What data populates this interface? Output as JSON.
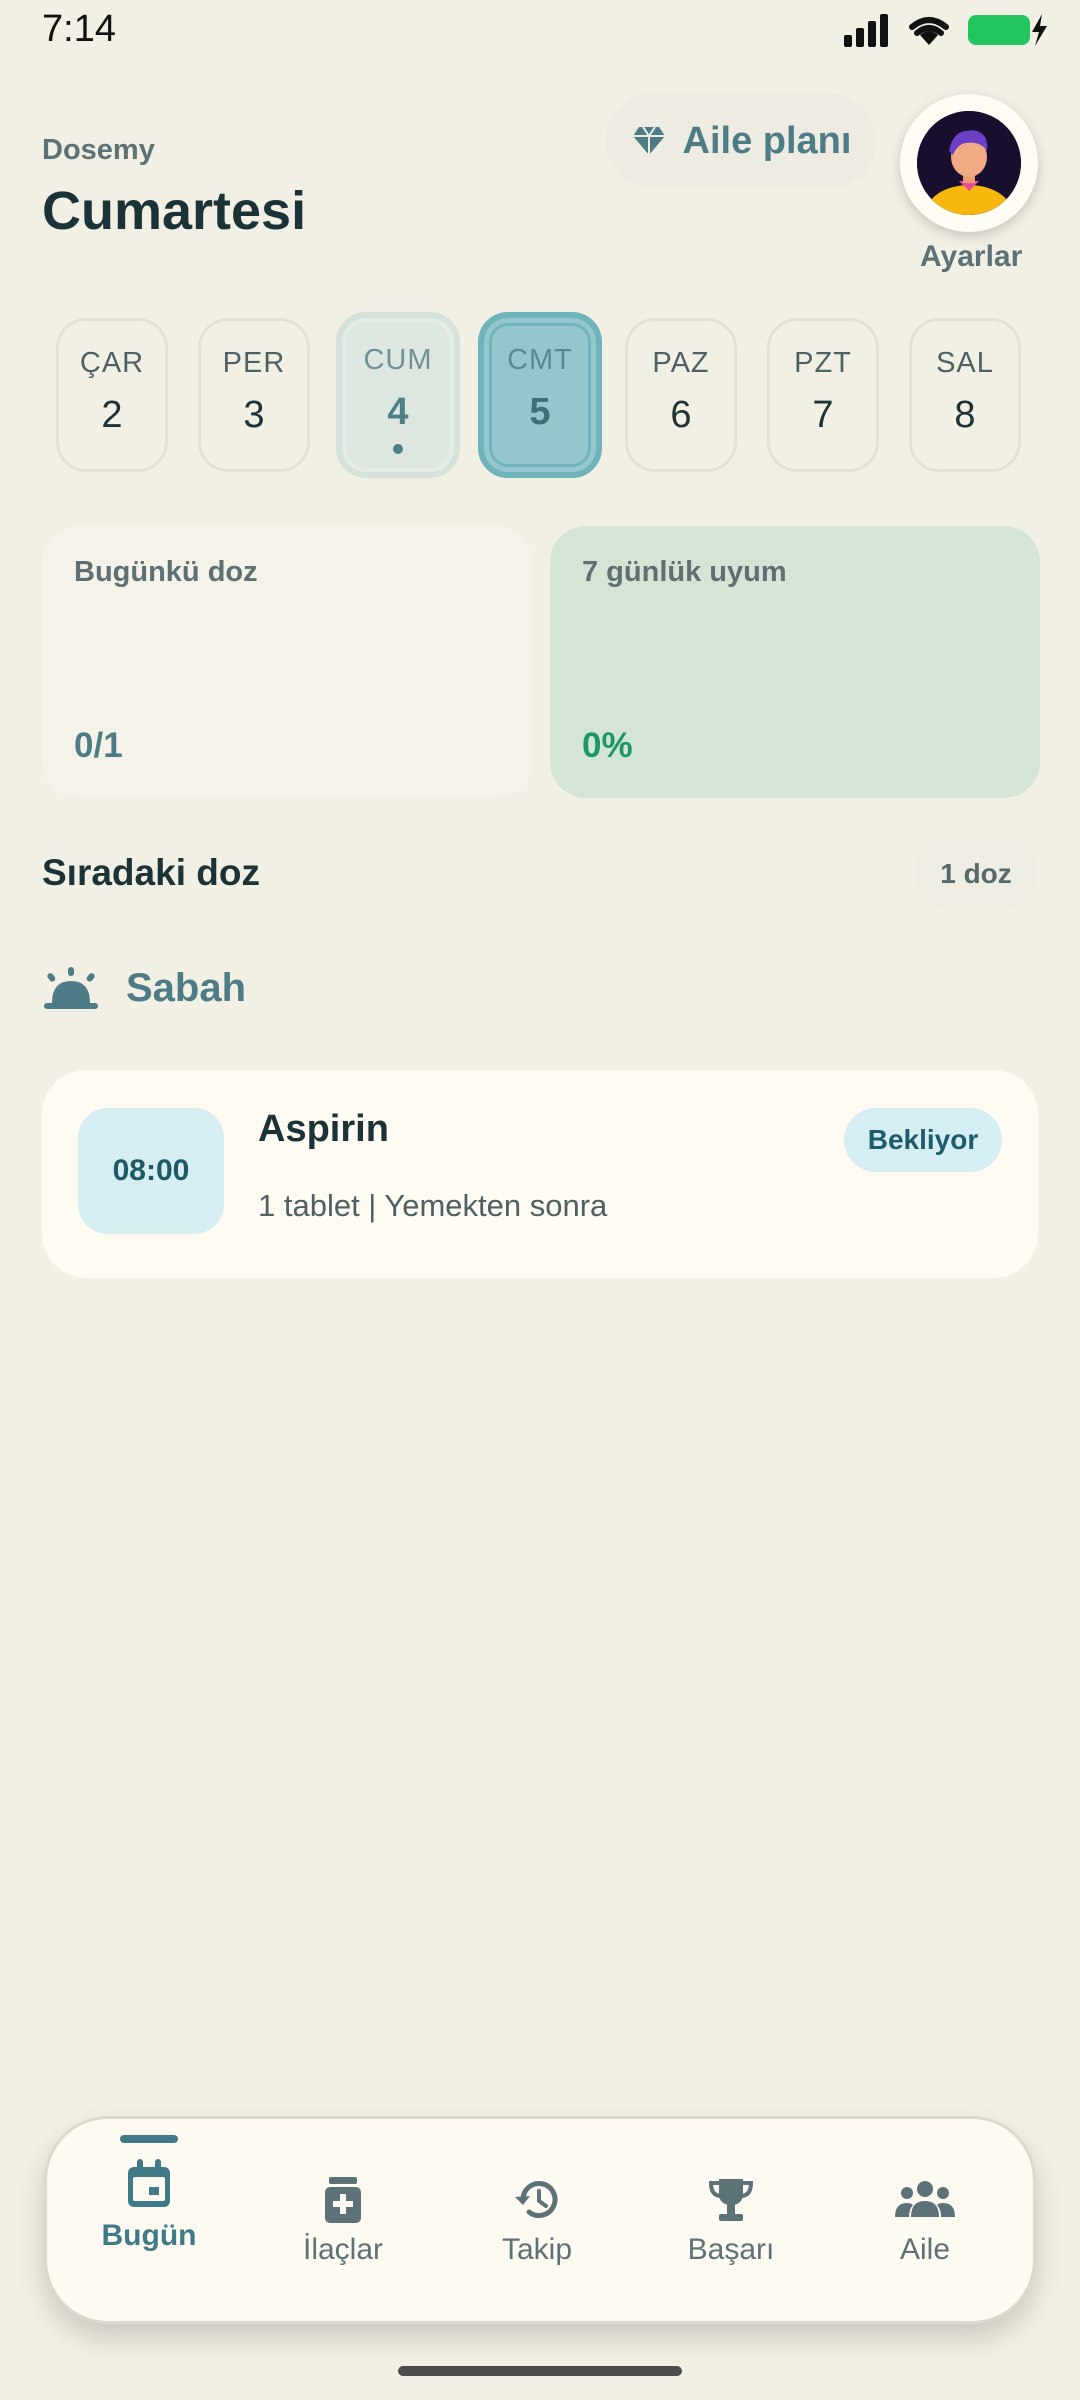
{
  "status_bar": {
    "time": "7:14"
  },
  "header": {
    "app_name": "Dosemy",
    "title": "Cumartesi",
    "family_plan_label": "Aile planı",
    "settings_label": "Ayarlar"
  },
  "days": [
    {
      "name": "ÇAR",
      "num": "2"
    },
    {
      "name": "PER",
      "num": "3"
    },
    {
      "name": "CUM",
      "num": "4"
    },
    {
      "name": "CMT",
      "num": "5"
    },
    {
      "name": "PAZ",
      "num": "6"
    },
    {
      "name": "PZT",
      "num": "7"
    },
    {
      "name": "SAL",
      "num": "8"
    }
  ],
  "stats": {
    "today_label": "Bugünkü doz",
    "today_value": "0/1",
    "compliance_label": "7 günlük uyum",
    "compliance_value": "0%"
  },
  "next_dose": {
    "title": "Sıradaki doz",
    "count": "1 doz",
    "period": "Sabah"
  },
  "medication": {
    "time": "08:00",
    "name": "Aspirin",
    "detail": "1 tablet | Yemekten sonra",
    "status": "Bekliyor"
  },
  "nav": {
    "today": "Bugün",
    "meds": "İlaçlar",
    "track": "Takip",
    "success": "Başarı",
    "family": "Aile"
  },
  "colors": {
    "background": "#F2EFE4",
    "accent": "#4E7C86",
    "success": "#1D9766",
    "selected_day": "#94C7CC"
  }
}
